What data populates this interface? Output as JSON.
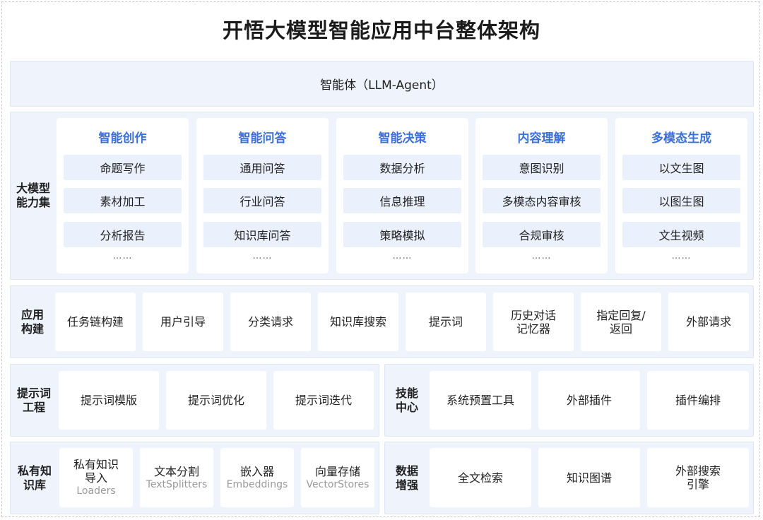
{
  "title": "开悟大模型智能应用中台整体架构",
  "agent": "智能体（LLM-Agent）",
  "capability": {
    "label_line1": "大模型",
    "label_line2": "能力集",
    "columns": [
      {
        "head": "智能创作",
        "items": [
          "命题写作",
          "素材加工",
          "分析报告"
        ],
        "more": "……"
      },
      {
        "head": "智能问答",
        "items": [
          "通用问答",
          "行业问答",
          "知识库问答"
        ],
        "more": "……"
      },
      {
        "head": "智能决策",
        "items": [
          "数据分析",
          "信息推理",
          "策略模拟"
        ],
        "more": "……"
      },
      {
        "head": "内容理解",
        "items": [
          "意图识别",
          "多模态内容审核",
          "合规审核"
        ],
        "more": "……"
      },
      {
        "head": "多模态生成",
        "items": [
          "以文生图",
          "以图生图",
          "文生视频"
        ],
        "more": "……"
      }
    ]
  },
  "app": {
    "label_line1": "应用",
    "label_line2": "构建",
    "items": [
      {
        "l1": "任务链构建",
        "l2": ""
      },
      {
        "l1": "用户引导",
        "l2": ""
      },
      {
        "l1": "分类请求",
        "l2": ""
      },
      {
        "l1": "知识库搜索",
        "l2": ""
      },
      {
        "l1": "提示词",
        "l2": ""
      },
      {
        "l1": "历史对话",
        "l2": "记忆器"
      },
      {
        "l1": "指定回复/",
        "l2": "返回"
      },
      {
        "l1": "外部请求",
        "l2": ""
      }
    ]
  },
  "prompt": {
    "label_line1": "提示词",
    "label_line2": "工程",
    "items": [
      "提示词模版",
      "提示词优化",
      "提示词迭代"
    ]
  },
  "skill": {
    "label_line1": "技能",
    "label_line2": "中心",
    "items": [
      "系统预置工具",
      "外部插件",
      "插件编排"
    ]
  },
  "kb": {
    "label_line1": "私有知",
    "label_line2": "识库",
    "items": [
      {
        "l1": "私有知识",
        "l2": "导入",
        "sub": "Loaders"
      },
      {
        "l1": "文本分割",
        "l2": "",
        "sub": "TextSplitters"
      },
      {
        "l1": "嵌入器",
        "l2": "",
        "sub": "Embeddings"
      },
      {
        "l1": "向量存储",
        "l2": "",
        "sub": "VectorStores"
      }
    ]
  },
  "data": {
    "label_line1": "数据",
    "label_line2": "增强",
    "items": [
      {
        "l1": "全文检索",
        "l2": ""
      },
      {
        "l1": "知识图谱",
        "l2": ""
      },
      {
        "l1": "外部搜索",
        "l2": "引擎"
      }
    ]
  },
  "colors": {
    "accent": "#3b6fd8",
    "panel_bg": "#eef3fc",
    "item_bg": "#eaf1fd"
  }
}
